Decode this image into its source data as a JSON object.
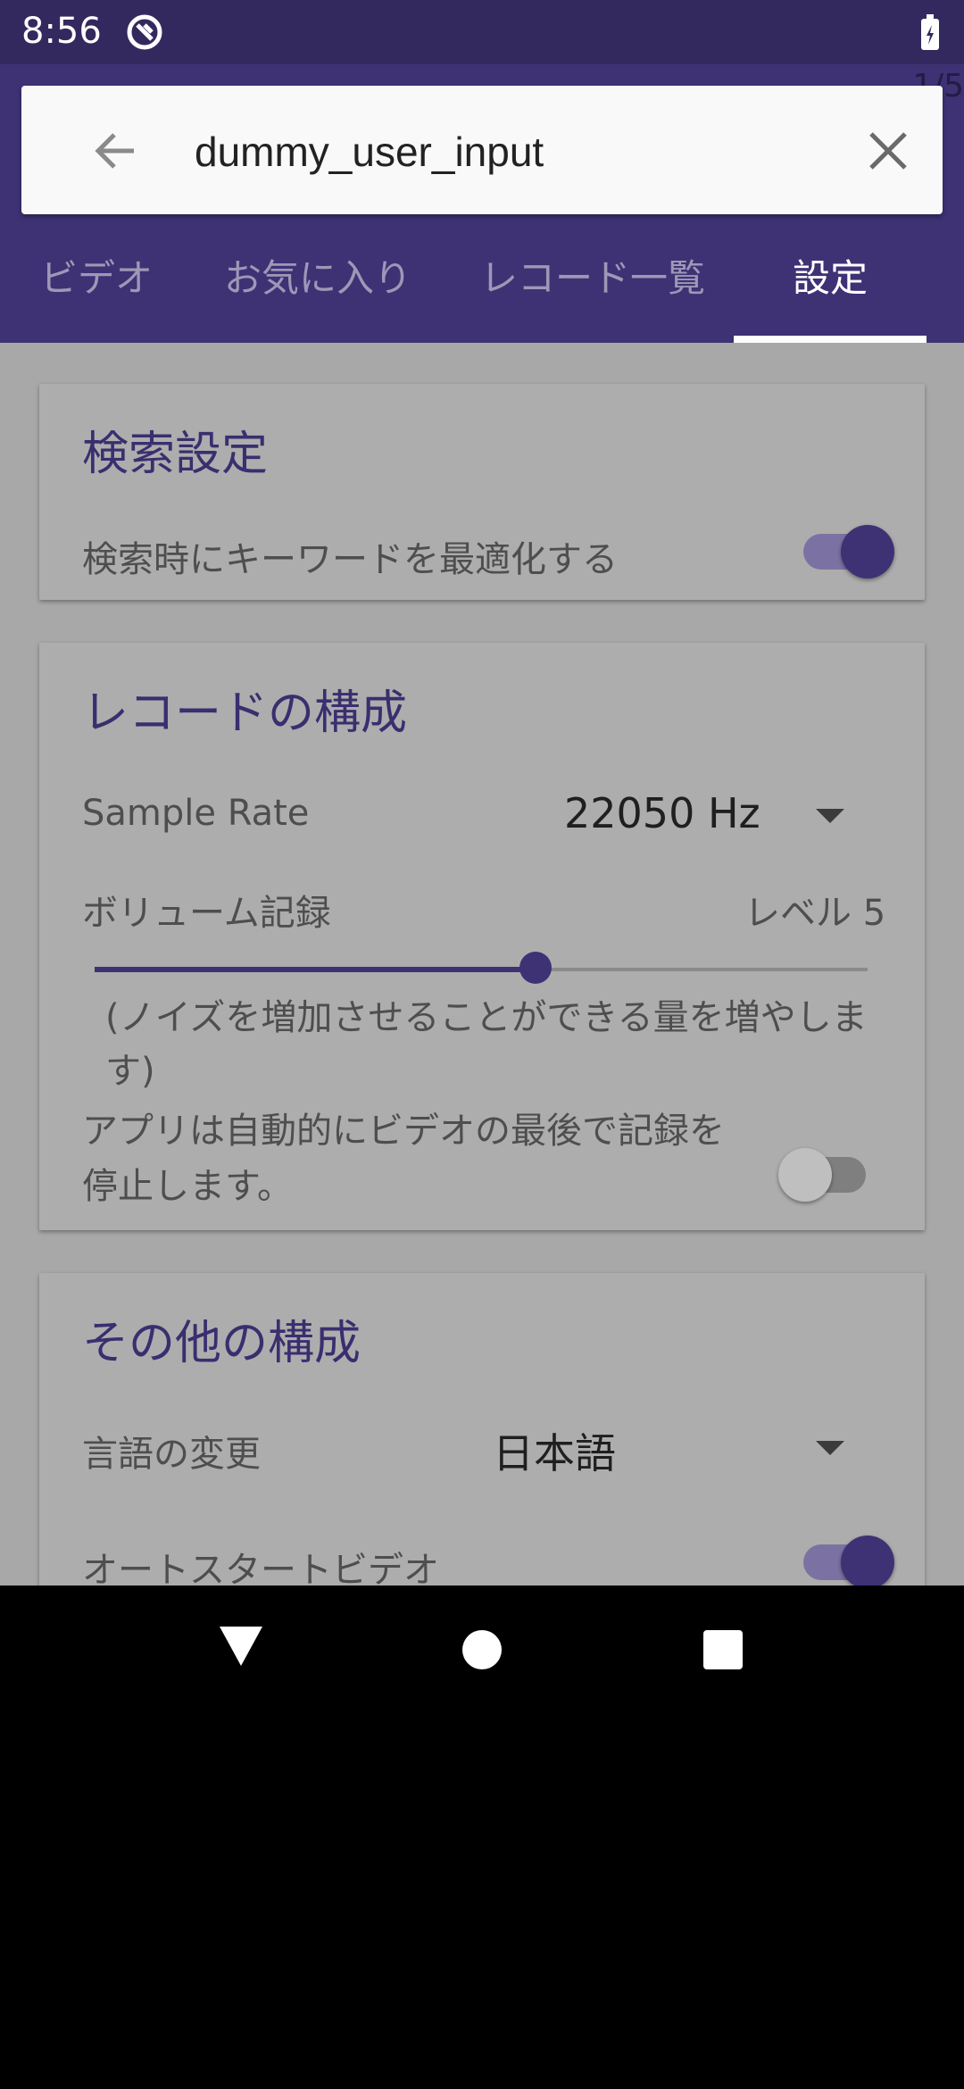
{
  "status_bar": {
    "time": "8:56"
  },
  "page_indicator": "1/5",
  "search": {
    "value": "dummy_user_input"
  },
  "tabs": [
    {
      "label": "ビデオ",
      "active": false
    },
    {
      "label": "お気に入り",
      "active": false
    },
    {
      "label": "レコード一覧",
      "active": false
    },
    {
      "label": "設定",
      "active": true
    }
  ],
  "search_settings": {
    "title": "検索設定",
    "optimize_label": "検索時にキーワードを最適化する",
    "optimize_on": true
  },
  "record_settings": {
    "title": "レコードの構成",
    "sample_rate_label": "Sample Rate",
    "sample_rate_value": "22050 Hz",
    "volume_label": "ボリューム記録",
    "volume_level_text": "レベル 5",
    "volume_fraction": 0.57,
    "volume_note": "(ノイズを増加させることができる量を増やします)",
    "auto_stop_label": "アプリは自動的にビデオの最後で記録を停止します。",
    "auto_stop_on": false
  },
  "other_settings": {
    "title": "その他の構成",
    "language_label": "言語の変更",
    "language_value": "日本語",
    "autostart_label": "オートスタートビデオ",
    "autostart_on": true
  },
  "colors": {
    "primary": "#3e3275",
    "status_bar": "#34295e",
    "overlay_bg": "#a8a8a8"
  }
}
